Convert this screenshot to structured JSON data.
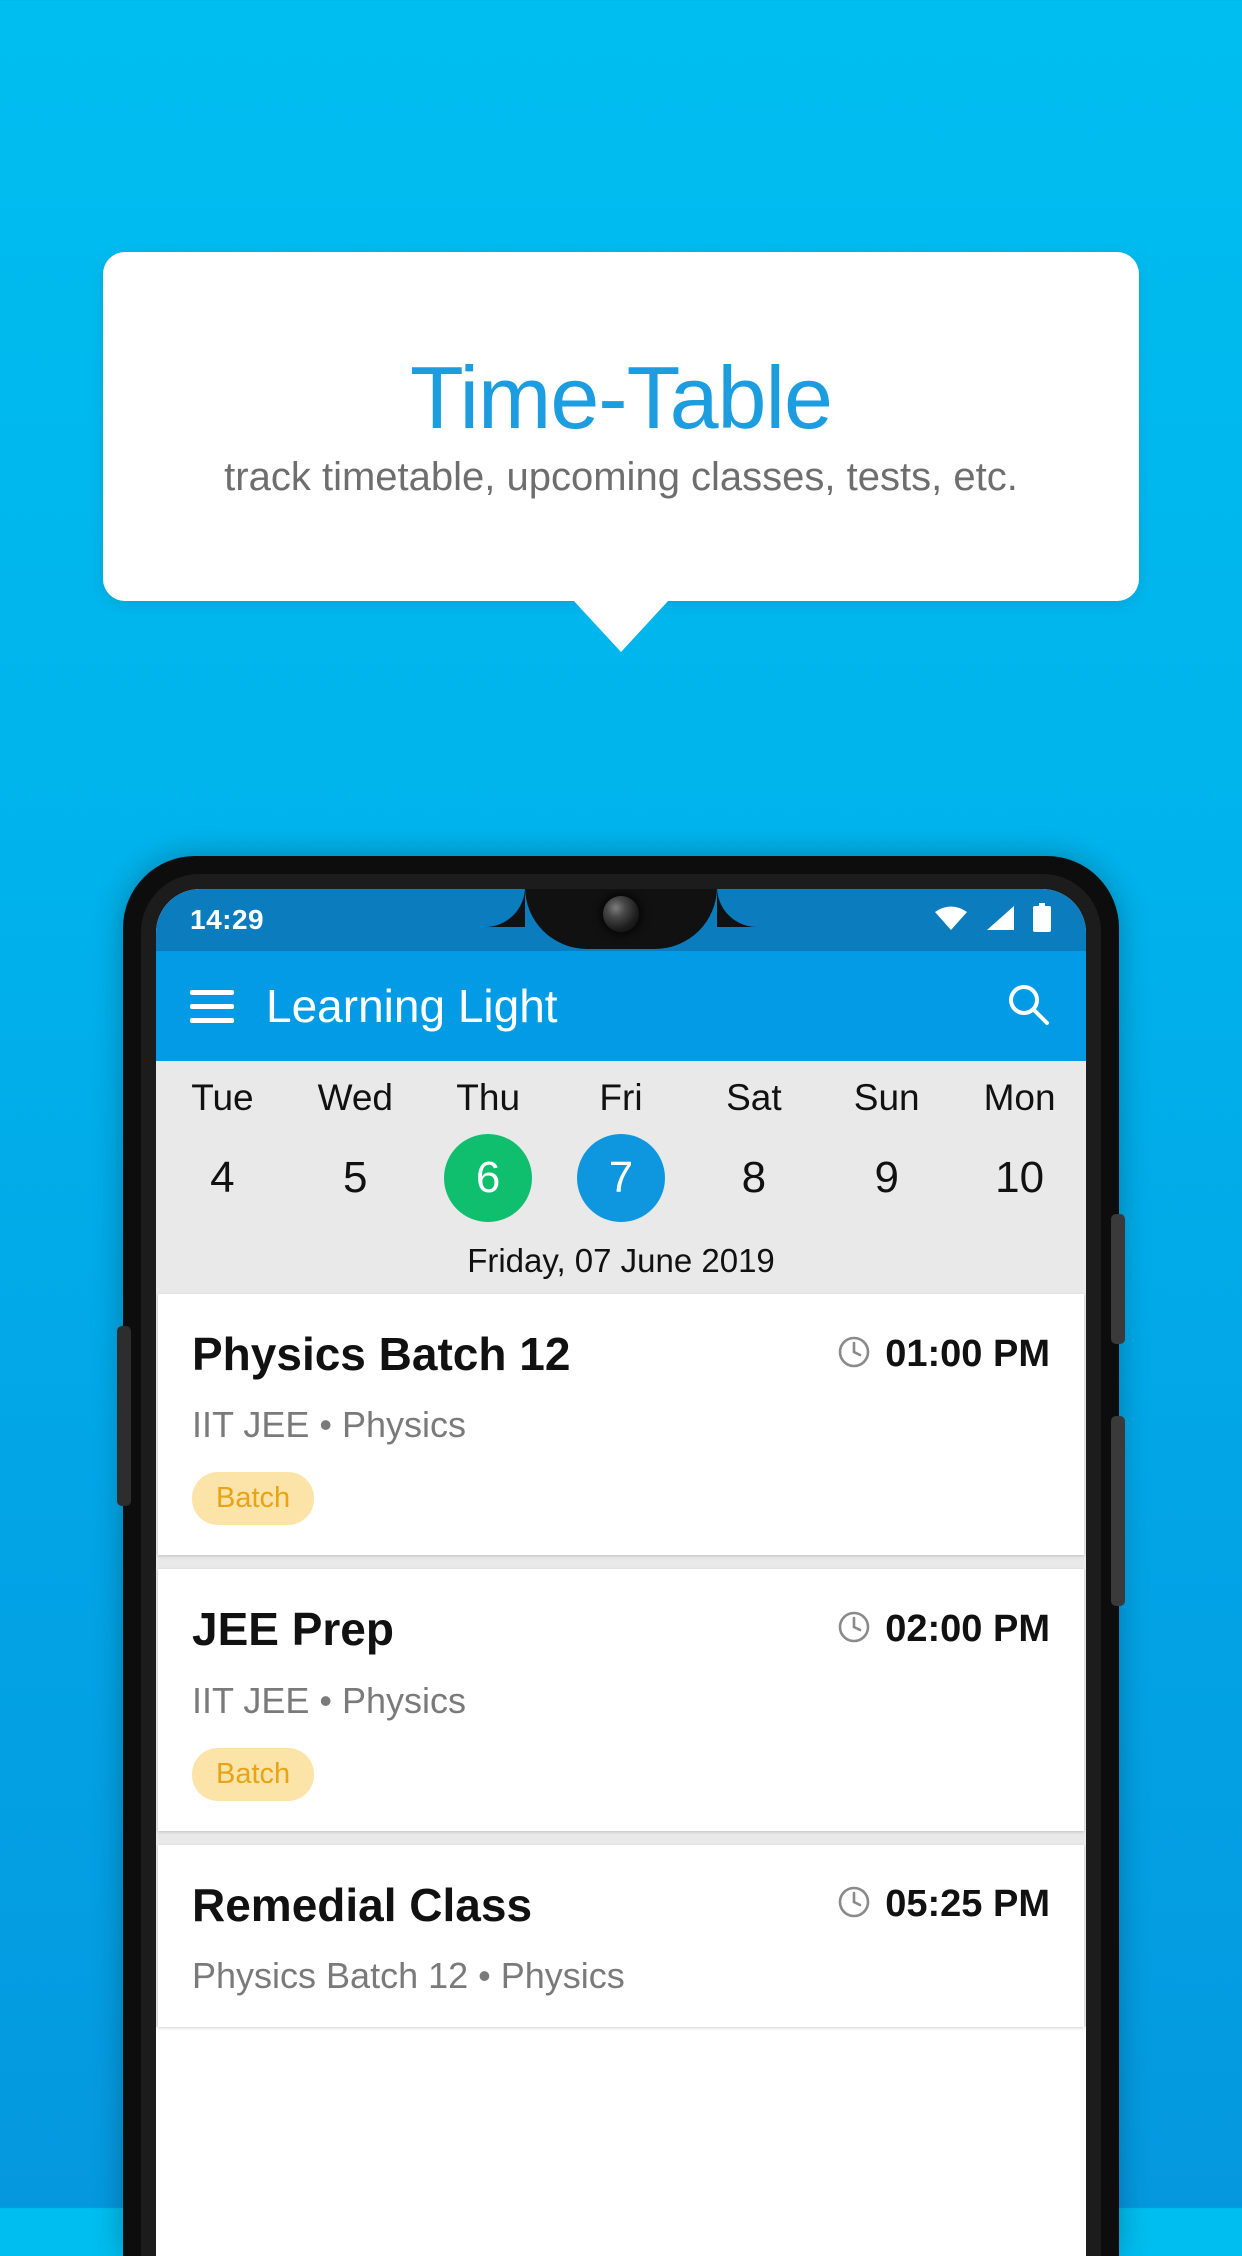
{
  "promo": {
    "title": "Time-Table",
    "subtitle": "track timetable, upcoming classes, tests, etc."
  },
  "colors": {
    "background_top": "#00BEF0",
    "background_bottom": "#0598DF",
    "title_blue": "#1B9DE0",
    "appbar_blue": "#039BE5",
    "statusbar_blue": "#0B7CBD",
    "today_green": "#0FBF6E",
    "selected_blue": "#0E96DE",
    "badge_bg": "#FCE3A8",
    "badge_text": "#E8A317",
    "strip_gray": "#E9E9E9"
  },
  "phone": {
    "statusbar": {
      "time": "14:29",
      "icons": [
        "wifi-icon",
        "signal-icon",
        "battery-icon"
      ]
    },
    "appbar": {
      "menu_icon": "hamburger-menu-icon",
      "title": "Learning Light",
      "search_icon": "search-icon"
    },
    "datestrip": {
      "days": [
        {
          "name": "Tue",
          "num": "4",
          "state": "normal"
        },
        {
          "name": "Wed",
          "num": "5",
          "state": "normal"
        },
        {
          "name": "Thu",
          "num": "6",
          "state": "today"
        },
        {
          "name": "Fri",
          "num": "7",
          "state": "selected"
        },
        {
          "name": "Sat",
          "num": "8",
          "state": "normal"
        },
        {
          "name": "Sun",
          "num": "9",
          "state": "normal"
        },
        {
          "name": "Mon",
          "num": "10",
          "state": "normal"
        }
      ],
      "full_date": "Friday, 07 June 2019"
    },
    "events": [
      {
        "title": "Physics Batch 12",
        "time": "01:00 PM",
        "time_icon": "clock-icon",
        "subtitle": "IIT JEE • Physics",
        "badge": "Batch"
      },
      {
        "title": "JEE Prep",
        "time": "02:00 PM",
        "time_icon": "clock-icon",
        "subtitle": "IIT JEE • Physics",
        "badge": "Batch"
      },
      {
        "title": "Remedial Class",
        "time": "05:25 PM",
        "time_icon": "clock-icon",
        "subtitle": "Physics Batch 12 • Physics",
        "badge": ""
      }
    ]
  }
}
